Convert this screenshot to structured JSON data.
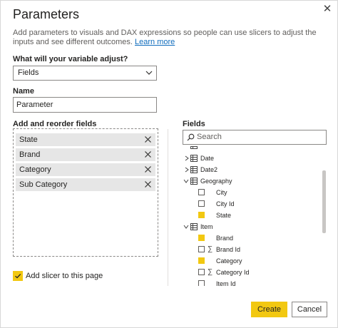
{
  "dialog": {
    "title": "Parameters",
    "description": "Add parameters to visuals and DAX expressions so people can use slicers to adjust the inputs and see different outcomes.",
    "learn_more": "Learn more"
  },
  "variable": {
    "label": "What will your variable adjust?",
    "value": "Fields"
  },
  "name": {
    "label": "Name",
    "value": "Parameter"
  },
  "reorder": {
    "label": "Add and reorder fields",
    "fields": [
      "State",
      "Brand",
      "Category",
      "Sub Category"
    ]
  },
  "slicer": {
    "label": "Add slicer to this page",
    "checked": true
  },
  "fields_pane": {
    "label": "Fields",
    "search_placeholder": "Search",
    "tree": [
      {
        "kind": "table",
        "label": "Date",
        "expanded": false
      },
      {
        "kind": "table",
        "label": "Date2",
        "expanded": false
      },
      {
        "kind": "table",
        "label": "Geography",
        "expanded": true
      },
      {
        "kind": "field",
        "label": "City",
        "checked": false,
        "sigma": false
      },
      {
        "kind": "field",
        "label": "City Id",
        "checked": false,
        "sigma": false
      },
      {
        "kind": "field",
        "label": "State",
        "checked": true,
        "sigma": false
      },
      {
        "kind": "table",
        "label": "Item",
        "expanded": true
      },
      {
        "kind": "field",
        "label": "Brand",
        "checked": true,
        "sigma": false
      },
      {
        "kind": "field",
        "label": "Brand Id",
        "checked": false,
        "sigma": true
      },
      {
        "kind": "field",
        "label": "Category",
        "checked": true,
        "sigma": false
      },
      {
        "kind": "field",
        "label": "Category Id",
        "checked": false,
        "sigma": true
      },
      {
        "kind": "field",
        "label": "Item Id",
        "checked": false,
        "sigma": false
      }
    ]
  },
  "buttons": {
    "create": "Create",
    "cancel": "Cancel"
  },
  "colors": {
    "accent": "#f2c811",
    "link": "#0f6cbd"
  }
}
